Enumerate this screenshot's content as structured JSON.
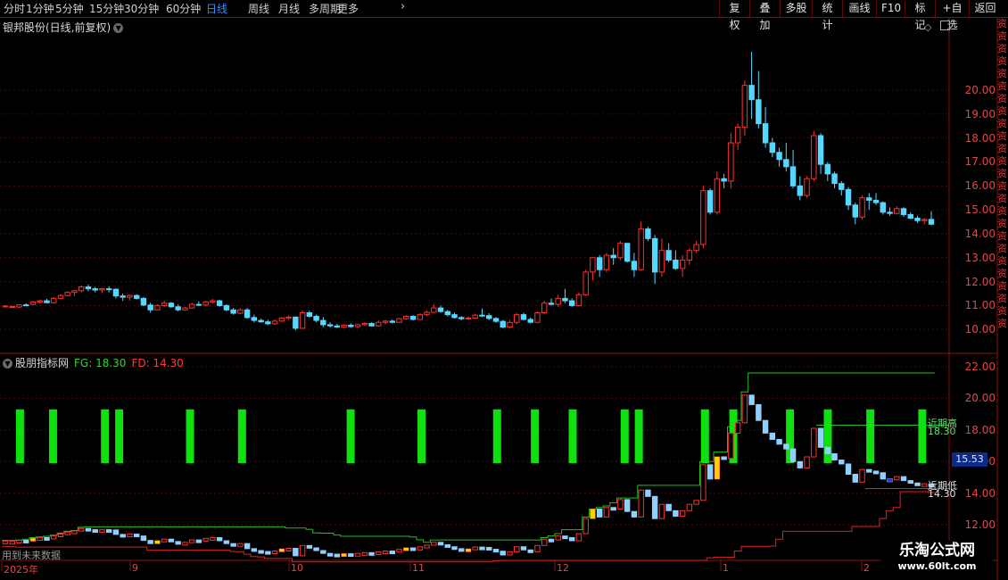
{
  "toolbar": {
    "periods": [
      "分时",
      "1分钟",
      "5分钟",
      "15分钟",
      "30分钟",
      "60分钟",
      "日线",
      "周线",
      "月线",
      "多周期",
      "更多"
    ],
    "active_period": "日线",
    "right_buttons": [
      "复权",
      "叠加",
      "多股",
      "统计",
      "画线",
      "F10",
      "标记",
      "+自选",
      "返回"
    ]
  },
  "main_chart": {
    "title": "银邦股份(日线,前复权)",
    "y_ticks": [
      "20.00",
      "19.00",
      "18.00",
      "17.00",
      "16.00",
      "15.00",
      "14.00",
      "13.00",
      "12.00",
      "11.00",
      "10.00"
    ]
  },
  "indicator": {
    "name": "股朋指标网",
    "fg_label": "FG: 18.30",
    "fd_label": "FD: 14.30",
    "y_ticks": [
      "22.00",
      "20.00",
      "18.00",
      "16.00",
      "14.00",
      "12.00"
    ],
    "price_tag": "15.53",
    "near_high_label": "近期高",
    "near_high_value": "18.30",
    "near_low_label": "近期低",
    "near_low_value": "14.30",
    "future_note": "用到未来数据"
  },
  "x_axis": [
    "2025年",
    "9",
    "10",
    "11",
    "12",
    "1",
    "2"
  ],
  "watermark": {
    "name": "乐淘公式网",
    "url": "www.60lt.com"
  },
  "right_strip": [
    "资",
    "资",
    "资",
    "资",
    "资",
    "资",
    "资",
    "资",
    "资",
    "资",
    "资",
    "资",
    "资",
    "资",
    "资",
    "资",
    "资",
    "资",
    "资",
    "资",
    "资",
    "资",
    "资",
    "资",
    "资"
  ],
  "colors": {
    "up": "#ff3030",
    "down": "#54d8ff",
    "green": "#10e010",
    "grid": "#4a0808",
    "frame": "#8a1010",
    "fg_line": "#20c020",
    "fd_line": "#e02020"
  },
  "chart_data": {
    "type": "candlestick",
    "title": "银邦股份(日线,前复权)",
    "candles": [
      [
        10.98,
        11.02,
        10.94,
        10.98
      ],
      [
        10.96,
        11.0,
        10.92,
        10.96
      ],
      [
        10.94,
        11.05,
        10.9,
        11.03
      ],
      [
        11.03,
        11.1,
        10.98,
        11.02
      ],
      [
        11.05,
        11.2,
        11.02,
        11.15
      ],
      [
        11.15,
        11.24,
        11.08,
        11.2
      ],
      [
        11.2,
        11.28,
        11.1,
        11.12
      ],
      [
        11.12,
        11.35,
        11.1,
        11.3
      ],
      [
        11.3,
        11.48,
        11.25,
        11.42
      ],
      [
        11.42,
        11.6,
        11.38,
        11.55
      ],
      [
        11.55,
        11.65,
        11.4,
        11.62
      ],
      [
        11.62,
        11.85,
        11.55,
        11.78
      ],
      [
        11.78,
        11.88,
        11.6,
        11.7
      ],
      [
        11.7,
        11.78,
        11.55,
        11.65
      ],
      [
        11.65,
        11.74,
        11.52,
        11.7
      ],
      [
        11.7,
        11.8,
        11.55,
        11.68
      ],
      [
        11.68,
        11.72,
        11.3,
        11.4
      ],
      [
        11.4,
        11.5,
        11.2,
        11.35
      ],
      [
        11.35,
        11.46,
        11.2,
        11.42
      ],
      [
        11.42,
        11.48,
        11.25,
        11.3
      ],
      [
        11.3,
        11.36,
        10.98,
        11.02
      ],
      [
        11.02,
        11.12,
        10.7,
        10.82
      ],
      [
        10.82,
        11.05,
        10.8,
        11.0
      ],
      [
        11.0,
        11.2,
        10.95,
        11.1
      ],
      [
        11.1,
        11.15,
        10.9,
        10.95
      ],
      [
        10.95,
        11.05,
        10.76,
        10.82
      ],
      [
        10.82,
        10.95,
        10.78,
        10.9
      ],
      [
        10.9,
        11.12,
        10.86,
        11.05
      ],
      [
        11.05,
        11.18,
        10.98,
        11.02
      ],
      [
        11.02,
        11.2,
        10.98,
        11.15
      ],
      [
        11.15,
        11.28,
        11.08,
        11.2
      ],
      [
        11.2,
        11.24,
        10.95,
        11.0
      ],
      [
        11.0,
        11.06,
        10.76,
        10.82
      ],
      [
        10.82,
        10.9,
        10.62,
        10.68
      ],
      [
        10.68,
        10.9,
        10.64,
        10.82
      ],
      [
        10.82,
        10.9,
        10.45,
        10.5
      ],
      [
        10.5,
        10.62,
        10.3,
        10.38
      ],
      [
        10.38,
        10.45,
        10.28,
        10.32
      ],
      [
        10.32,
        10.4,
        10.18,
        10.24
      ],
      [
        10.24,
        10.42,
        10.2,
        10.35
      ],
      [
        10.35,
        10.52,
        10.32,
        10.48
      ],
      [
        10.48,
        10.58,
        10.4,
        10.52
      ],
      [
        10.52,
        10.55,
        9.96,
        10.05
      ],
      [
        10.05,
        10.8,
        10.02,
        10.7
      ],
      [
        10.7,
        10.78,
        10.5,
        10.55
      ],
      [
        10.55,
        10.62,
        10.3,
        10.38
      ],
      [
        10.38,
        10.52,
        10.1,
        10.2
      ],
      [
        10.2,
        10.3,
        10.08,
        10.15
      ],
      [
        10.15,
        10.24,
        10.06,
        10.1
      ],
      [
        10.1,
        10.22,
        10.06,
        10.18
      ],
      [
        10.18,
        10.25,
        10.08,
        10.12
      ],
      [
        10.12,
        10.24,
        10.08,
        10.2
      ],
      [
        10.2,
        10.3,
        10.16,
        10.25
      ],
      [
        10.25,
        10.3,
        10.12,
        10.15
      ],
      [
        10.15,
        10.38,
        10.12,
        10.3
      ],
      [
        10.3,
        10.4,
        10.22,
        10.35
      ],
      [
        10.35,
        10.42,
        10.25,
        10.3
      ],
      [
        10.3,
        10.48,
        10.28,
        10.45
      ],
      [
        10.45,
        10.6,
        10.4,
        10.55
      ],
      [
        10.55,
        10.6,
        10.38,
        10.42
      ],
      [
        10.42,
        10.68,
        10.4,
        10.62
      ],
      [
        10.62,
        10.8,
        10.55,
        10.72
      ],
      [
        10.72,
        11.05,
        10.68,
        10.9
      ],
      [
        10.9,
        11.0,
        10.7,
        10.75
      ],
      [
        10.75,
        10.82,
        10.55,
        10.62
      ],
      [
        10.62,
        10.7,
        10.45,
        10.5
      ],
      [
        10.5,
        10.56,
        10.38,
        10.45
      ],
      [
        10.45,
        10.54,
        10.4,
        10.48
      ],
      [
        10.48,
        10.66,
        10.44,
        10.6
      ],
      [
        10.6,
        10.88,
        10.52,
        10.58
      ],
      [
        10.58,
        10.68,
        10.4,
        10.46
      ],
      [
        10.46,
        10.52,
        10.28,
        10.34
      ],
      [
        10.34,
        10.4,
        10.05,
        10.1
      ],
      [
        10.1,
        10.4,
        10.06,
        10.3
      ],
      [
        10.3,
        10.7,
        10.22,
        10.62
      ],
      [
        10.62,
        10.7,
        10.38,
        10.42
      ],
      [
        10.42,
        10.5,
        10.25,
        10.3
      ],
      [
        10.3,
        10.75,
        10.26,
        10.7
      ],
      [
        10.7,
        11.2,
        10.65,
        11.1
      ],
      [
        11.1,
        11.3,
        11.0,
        11.05
      ],
      [
        11.05,
        11.45,
        10.95,
        11.3
      ],
      [
        11.3,
        11.7,
        11.1,
        11.2
      ],
      [
        11.2,
        11.3,
        10.95,
        11.0
      ],
      [
        11.0,
        11.55,
        10.96,
        11.45
      ],
      [
        11.45,
        12.5,
        11.4,
        12.4
      ],
      [
        12.4,
        13.0,
        12.05,
        13.0
      ],
      [
        13.0,
        13.1,
        12.2,
        12.5
      ],
      [
        12.5,
        13.2,
        12.4,
        13.1
      ],
      [
        13.1,
        13.4,
        12.7,
        13.0
      ],
      [
        13.0,
        13.7,
        12.9,
        13.6
      ],
      [
        13.6,
        13.6,
        12.8,
        12.85
      ],
      [
        12.85,
        13.2,
        12.2,
        12.5
      ],
      [
        12.5,
        14.5,
        12.45,
        14.2
      ],
      [
        14.2,
        14.3,
        13.7,
        13.8
      ],
      [
        13.8,
        13.95,
        11.9,
        12.4
      ],
      [
        12.4,
        13.8,
        12.2,
        13.3
      ],
      [
        13.3,
        13.6,
        12.8,
        12.9
      ],
      [
        12.9,
        13.3,
        12.5,
        12.55
      ],
      [
        12.55,
        13.1,
        12.2,
        12.9
      ],
      [
        12.9,
        13.4,
        12.7,
        13.3
      ],
      [
        13.3,
        13.7,
        13.2,
        13.55
      ],
      [
        13.55,
        16.0,
        13.4,
        15.8
      ],
      [
        15.8,
        15.9,
        14.8,
        14.9
      ],
      [
        14.9,
        16.6,
        14.8,
        16.3
      ],
      [
        16.3,
        16.5,
        15.9,
        16.2
      ],
      [
        16.2,
        18.2,
        15.9,
        17.8
      ],
      [
        17.8,
        18.6,
        17.5,
        18.45
      ],
      [
        18.45,
        20.4,
        18.1,
        20.2
      ],
      [
        20.2,
        21.6,
        18.8,
        19.6
      ],
      [
        19.6,
        20.8,
        18.4,
        18.6
      ],
      [
        18.6,
        19.3,
        17.6,
        17.8
      ],
      [
        17.8,
        18.0,
        17.2,
        17.4
      ],
      [
        17.4,
        17.6,
        16.8,
        17.1
      ],
      [
        17.1,
        17.8,
        16.6,
        16.8
      ],
      [
        16.8,
        17.5,
        15.9,
        16.0
      ],
      [
        16.0,
        16.4,
        15.4,
        15.6
      ],
      [
        15.6,
        16.4,
        15.5,
        16.3
      ],
      [
        16.3,
        18.3,
        16.2,
        18.1
      ],
      [
        18.1,
        18.2,
        16.5,
        16.9
      ],
      [
        16.9,
        17.0,
        16.2,
        16.5
      ],
      [
        16.5,
        16.6,
        15.9,
        16.1
      ],
      [
        16.1,
        16.2,
        15.6,
        15.85
      ],
      [
        15.85,
        15.95,
        15.0,
        15.2
      ],
      [
        15.2,
        15.3,
        14.4,
        14.7
      ],
      [
        14.7,
        15.6,
        14.6,
        15.5
      ],
      [
        15.5,
        15.7,
        15.0,
        15.4
      ],
      [
        15.4,
        15.7,
        15.2,
        15.3
      ],
      [
        15.3,
        15.35,
        14.8,
        14.9
      ],
      [
        14.9,
        15.1,
        14.75,
        14.85
      ],
      [
        14.85,
        15.15,
        14.8,
        15.05
      ],
      [
        15.05,
        15.1,
        14.7,
        14.8
      ],
      [
        14.8,
        14.9,
        14.6,
        14.65
      ],
      [
        14.65,
        14.75,
        14.45,
        14.55
      ],
      [
        14.55,
        14.65,
        14.4,
        14.6
      ],
      [
        14.6,
        14.95,
        14.35,
        14.4
      ]
    ],
    "y_range": [
      9.6,
      22.2
    ],
    "indicator": {
      "name": "股朋指标网",
      "FG": 18.3,
      "FD": 14.3,
      "y_range": [
        11.0,
        22.5
      ],
      "signal_bars_at": [
        3,
        10,
        21,
        24,
        39,
        50,
        73,
        88,
        104,
        112,
        120,
        131,
        134,
        148,
        154,
        166,
        174,
        183,
        194
      ]
    },
    "x_labels": [
      "2025年",
      "9",
      "10",
      "11",
      "12",
      "1",
      "2"
    ]
  }
}
